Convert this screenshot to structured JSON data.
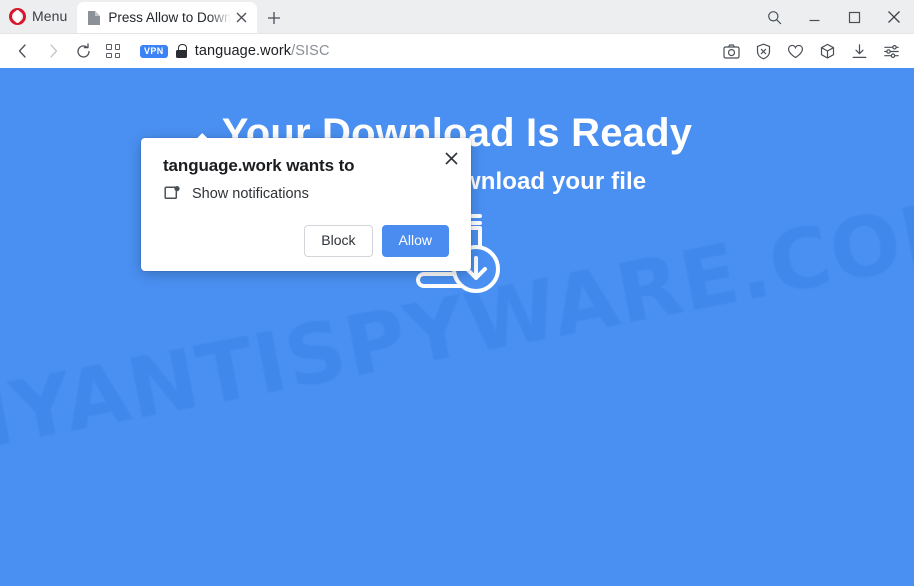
{
  "browser": {
    "name": "Opera",
    "menu_label": "Menu",
    "tab": {
      "title": "Press Allow to Downl",
      "favicon_name": "page-favicon",
      "close_name": "close-icon"
    },
    "new_tab_label": "+",
    "window_controls": [
      {
        "name": "search-icon",
        "glyph": "search"
      },
      {
        "name": "minimize-icon",
        "glyph": "minimize"
      },
      {
        "name": "maximize-icon",
        "glyph": "maximize"
      },
      {
        "name": "close-window-icon",
        "glyph": "close"
      }
    ],
    "nav": [
      {
        "name": "back-button",
        "glyph": "chevron-left",
        "enabled": true
      },
      {
        "name": "forward-button",
        "glyph": "chevron-right",
        "enabled": false
      },
      {
        "name": "reload-button",
        "glyph": "reload",
        "enabled": true
      },
      {
        "name": "speed-dial-button",
        "glyph": "grid",
        "enabled": true
      }
    ],
    "address": {
      "vpn_badge": "VPN",
      "lock_name": "lock-icon",
      "url_domain": "tanguage.work",
      "url_path": "/SISC",
      "full_url": "tanguage.work/SISC"
    },
    "toolbar_icons": [
      {
        "name": "snapshot-icon",
        "glyph": "camera"
      },
      {
        "name": "ad-blocker-icon",
        "glyph": "shield-x"
      },
      {
        "name": "favorites-icon",
        "glyph": "heart"
      },
      {
        "name": "extensions-icon",
        "glyph": "cube"
      },
      {
        "name": "downloads-icon",
        "glyph": "download"
      },
      {
        "name": "easy-setup-icon",
        "glyph": "sliders"
      }
    ]
  },
  "page": {
    "background_color": "#4a90f2",
    "watermark": "MYANTISPYWARE.COM",
    "headline": "Your Download Is Ready",
    "subtitle": "Click Allow to download your file",
    "hero_icon_name": "book-download-icon"
  },
  "permission_dialog": {
    "title": "tanguage.work wants to",
    "permission_icon_name": "notification-icon",
    "permission_label": "Show notifications",
    "block_label": "Block",
    "allow_label": "Allow",
    "close_label": "×",
    "allow_color": "#4a8cf0"
  }
}
